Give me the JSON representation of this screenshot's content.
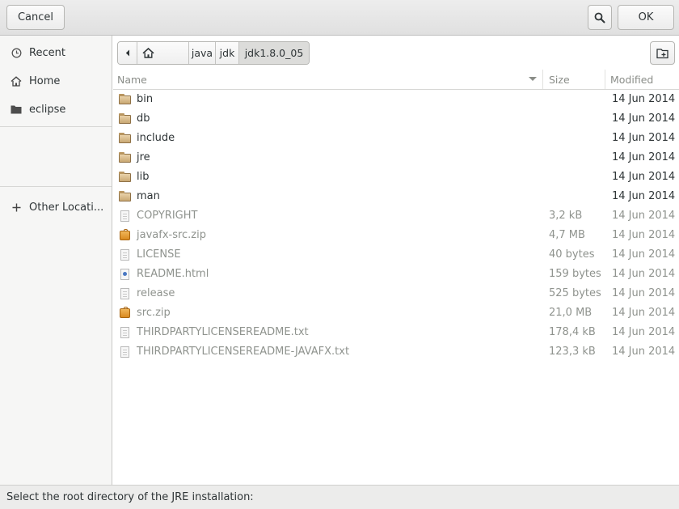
{
  "header": {
    "cancel_label": "Cancel",
    "ok_label": "OK",
    "search_icon": "search-icon"
  },
  "sidebar": {
    "items": [
      {
        "label": "Recent",
        "icon": "clock-icon"
      },
      {
        "label": "Home",
        "icon": "home-icon"
      },
      {
        "label": "eclipse",
        "icon": "folder-icon"
      },
      {
        "label": "Other Locati...",
        "icon": "plus-icon"
      }
    ]
  },
  "pathbar": {
    "segments": [
      "",
      "java",
      "jdk",
      "jdk1.8.0_05"
    ],
    "home_icon": "home-icon",
    "back_icon": "left-arrow-icon",
    "new_folder_icon": "new-folder-icon"
  },
  "columns": {
    "name": "Name",
    "size": "Size",
    "modified": "Modified"
  },
  "files": [
    {
      "name": "bin",
      "size": "",
      "modified": "14 Jun 2014",
      "type": "folder"
    },
    {
      "name": "db",
      "size": "",
      "modified": "14 Jun 2014",
      "type": "folder"
    },
    {
      "name": "include",
      "size": "",
      "modified": "14 Jun 2014",
      "type": "folder"
    },
    {
      "name": "jre",
      "size": "",
      "modified": "14 Jun 2014",
      "type": "folder"
    },
    {
      "name": "lib",
      "size": "",
      "modified": "14 Jun 2014",
      "type": "folder"
    },
    {
      "name": "man",
      "size": "",
      "modified": "14 Jun 2014",
      "type": "folder"
    },
    {
      "name": "COPYRIGHT",
      "size": "3,2 kB",
      "modified": "14 Jun 2014",
      "type": "text"
    },
    {
      "name": "javafx-src.zip",
      "size": "4,7 MB",
      "modified": "14 Jun 2014",
      "type": "zip"
    },
    {
      "name": "LICENSE",
      "size": "40 bytes",
      "modified": "14 Jun 2014",
      "type": "text"
    },
    {
      "name": "README.html",
      "size": "159 bytes",
      "modified": "14 Jun 2014",
      "type": "html"
    },
    {
      "name": "release",
      "size": "525 bytes",
      "modified": "14 Jun 2014",
      "type": "text"
    },
    {
      "name": "src.zip",
      "size": "21,0 MB",
      "modified": "14 Jun 2014",
      "type": "zip"
    },
    {
      "name": "THIRDPARTYLICENSEREADME.txt",
      "size": "178,4 kB",
      "modified": "14 Jun 2014",
      "type": "text"
    },
    {
      "name": "THIRDPARTYLICENSEREADME-JAVAFX.txt",
      "size": "123,3 kB",
      "modified": "14 Jun 2014",
      "type": "text"
    }
  ],
  "status": {
    "text": "Select the root directory of the JRE installation:"
  }
}
